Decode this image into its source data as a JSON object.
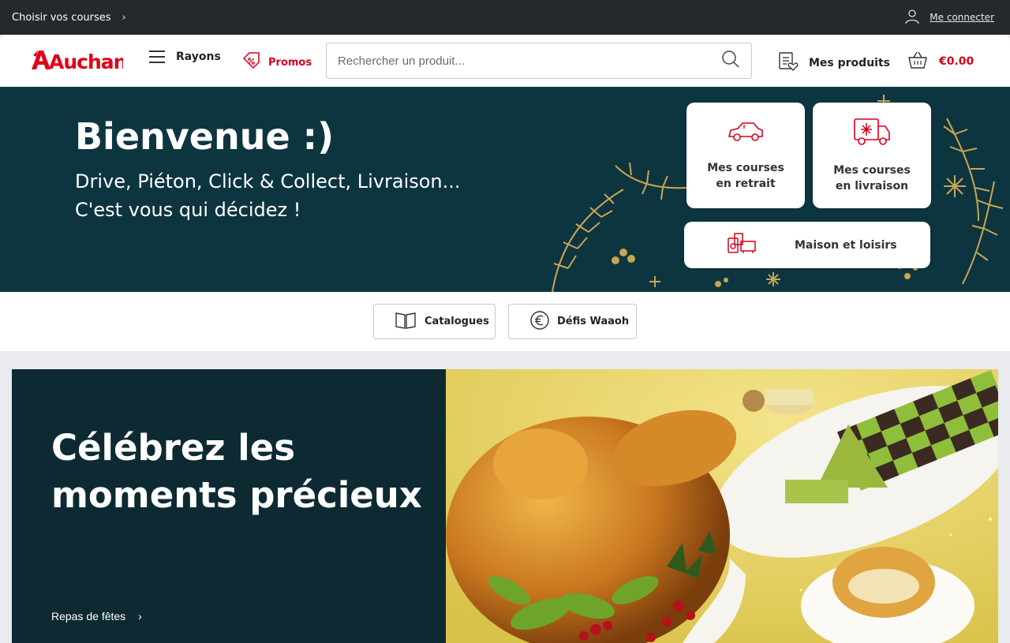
{
  "topbar": {
    "choose_label": "Choisir vos courses",
    "chevron": "›",
    "login_label": "Me connecter"
  },
  "header": {
    "logo_text": "Auchan",
    "rayons_label": "Rayons",
    "promos_label": "Promos",
    "search_placeholder": "Rechercher un produit...",
    "mes_produits_label": "Mes produits",
    "cart_total": "€0.00"
  },
  "hero": {
    "title": "Bienvenue :)",
    "subtitle_line1": "Drive, Piéton, Click & Collect, Livraison...",
    "subtitle_line2": "C'est vous qui décidez !",
    "cards": {
      "retrait_line1": "Mes courses",
      "retrait_line2": "en retrait",
      "livraison_line1": "Mes courses",
      "livraison_line2": "en livraison",
      "maison": "Maison et loisirs"
    }
  },
  "quicklinks": {
    "catalogues": "Catalogues",
    "defis": "Défis Waaoh"
  },
  "banner": {
    "title": "Célébrez les moments précieux",
    "link_label": "Repas de fêtes",
    "chevron": "›"
  },
  "colors": {
    "brand_red": "#e0001a",
    "hero_bg": "#0d3540",
    "banner_bg": "#0d2a33",
    "topbar_bg": "#24292e"
  }
}
